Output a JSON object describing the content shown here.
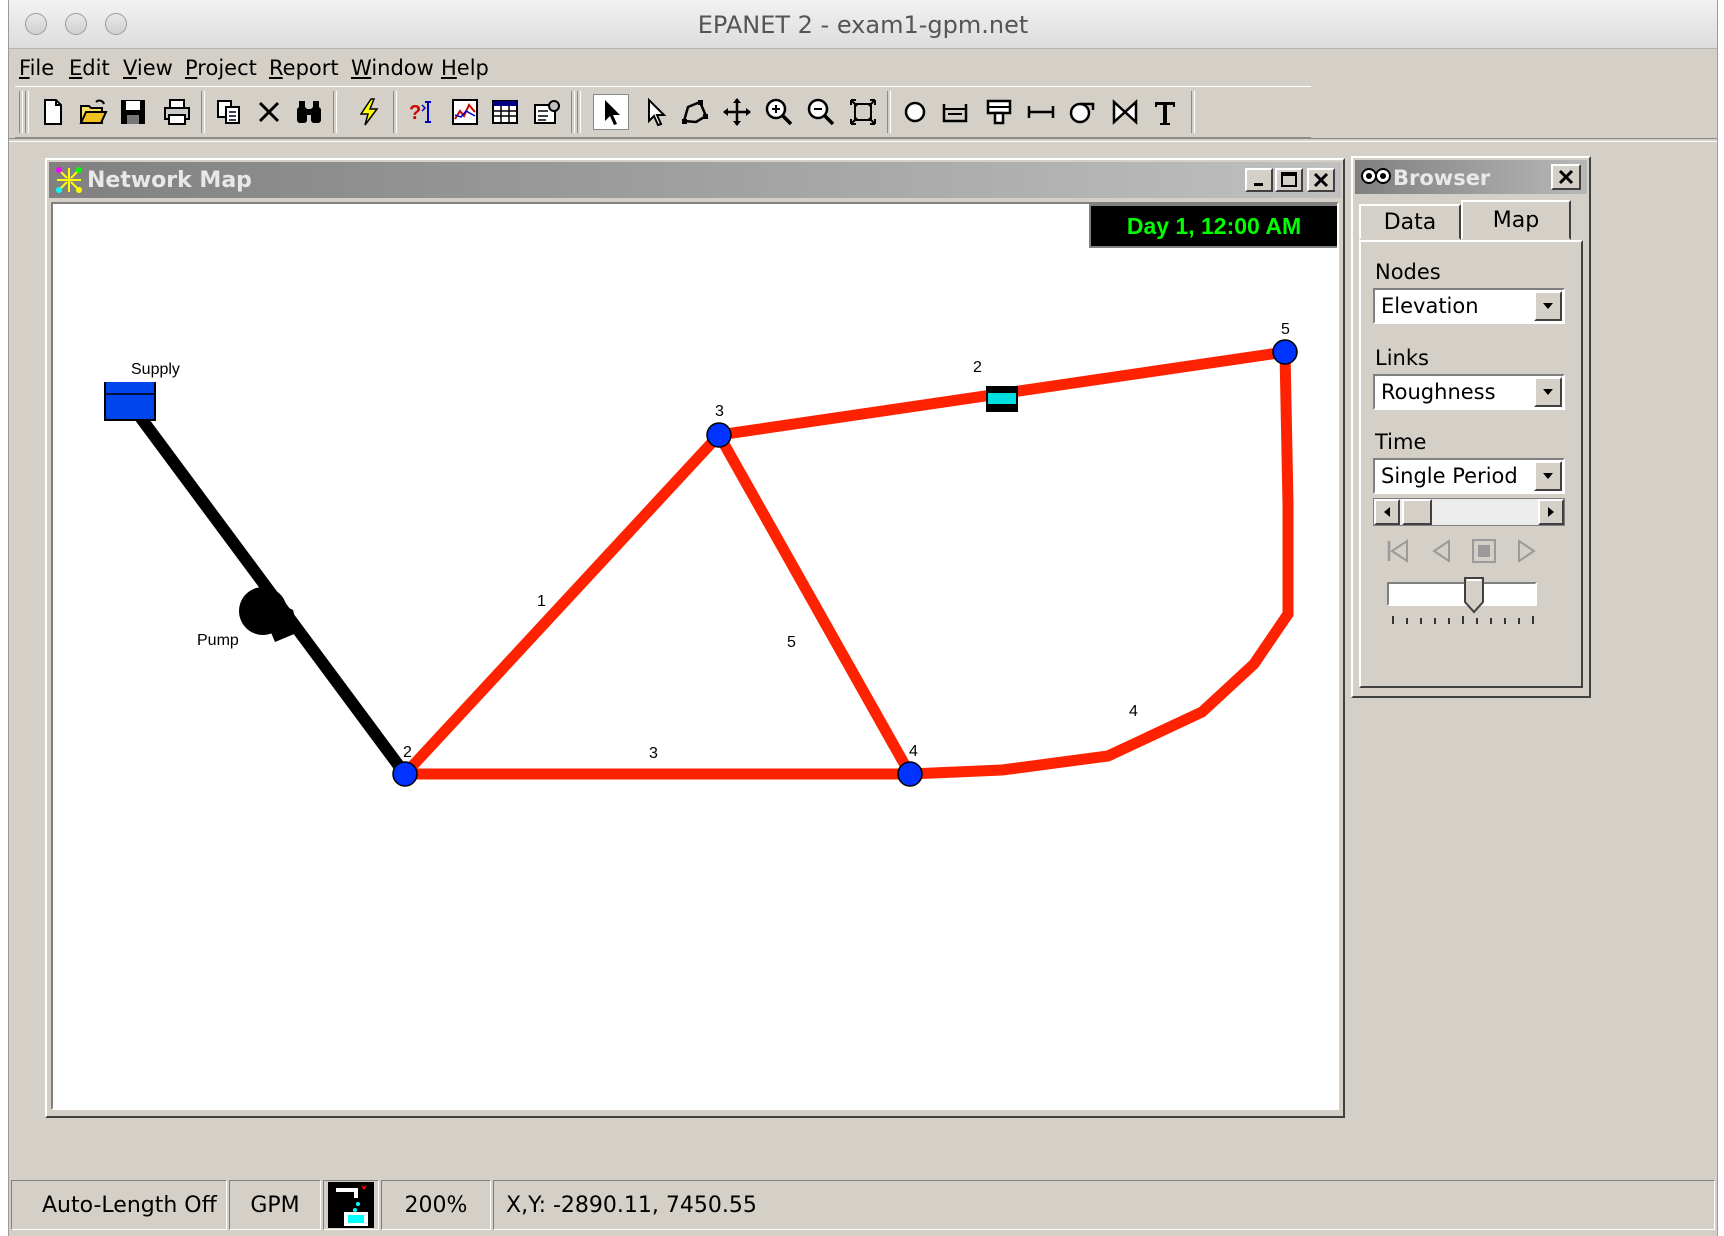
{
  "window": {
    "title": "EPANET 2 - exam1-gpm.net"
  },
  "menu": [
    "File",
    "Edit",
    "View",
    "Project",
    "Report",
    "Window",
    "Help"
  ],
  "toolbar": {
    "file_tools": [
      "new-file-icon",
      "open-file-icon",
      "save-icon",
      "print-icon"
    ],
    "edit_tools": [
      "copy-icon",
      "delete-icon",
      "find-icon"
    ],
    "run_tools": [
      "run-analysis-icon"
    ],
    "report_tools": [
      "query-icon",
      "graph-icon",
      "table-icon",
      "options-icon"
    ],
    "map_tools": [
      "select-object-icon",
      "select-vertex-icon",
      "select-region-icon",
      "pan-icon",
      "zoom-in-icon",
      "zoom-out-icon",
      "full-extent-icon",
      "add-junction-icon",
      "add-reservoir-icon",
      "add-tank-icon",
      "add-pipe-icon",
      "add-pump-icon",
      "add-valve-icon",
      "add-label-icon"
    ],
    "active_tool": "select-object"
  },
  "network_map": {
    "title": "Network Map",
    "clock": "Day 1, 12:00 AM",
    "reservoir_label": "Supply",
    "pump_label": "Pump",
    "node_labels": [
      "2",
      "3",
      "4",
      "5"
    ],
    "link_labels": [
      "1",
      "3",
      "5",
      "4"
    ],
    "valve_label": "2",
    "colors": {
      "pipe": "#ff2200",
      "pump_link": "#000000",
      "node": "#0033ff",
      "valve": "#00e0e0",
      "reservoir": "#0044ee"
    }
  },
  "browser": {
    "title": "Browser",
    "tabs": [
      "Data",
      "Map"
    ],
    "active_tab": "Map",
    "nodes_label": "Nodes",
    "nodes_value": "Elevation",
    "links_label": "Links",
    "links_value": "Roughness",
    "time_label": "Time",
    "time_value": "Single Period"
  },
  "status": {
    "auto_length": "Auto-Length Off",
    "units": "GPM",
    "zoom": "200%",
    "xy": "X,Y: -2890.11, 7450.55"
  }
}
